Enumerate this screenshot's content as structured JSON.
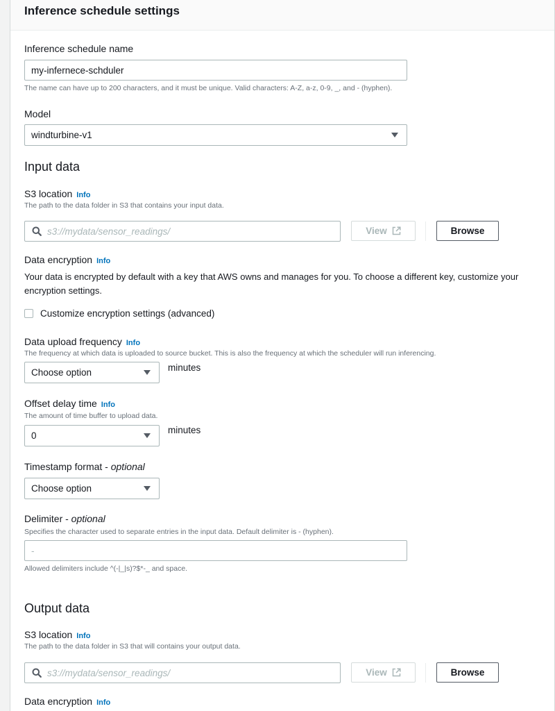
{
  "panel": {
    "title": "Inference schedule settings"
  },
  "name_field": {
    "label": "Inference schedule name",
    "value": "my-infernece-schduler",
    "hint": "The name can have up to 200 characters, and it must be unique. Valid characters: A-Z, a-z, 0-9, _, and - (hyphen)."
  },
  "model_field": {
    "label": "Model",
    "selected": "windturbine-v1"
  },
  "input_data": {
    "heading": "Input data",
    "s3": {
      "label": "S3 location",
      "info": "Info",
      "description": "The path to the data folder in S3 that contains your input data.",
      "placeholder": "s3://mydata/sensor_readings/",
      "view_label": "View",
      "browse_label": "Browse"
    },
    "encryption": {
      "label": "Data encryption",
      "info": "Info",
      "text": "Your data is encrypted by default with a key that AWS owns and manages for you. To choose a different key, customize your encryption settings.",
      "checkbox_label": "Customize encryption settings (advanced)",
      "checkbox_checked": false
    },
    "upload_frequency": {
      "label": "Data upload frequency",
      "info": "Info",
      "description": "The frequency at which data is uploaded to source bucket. This is also the frequency at which the scheduler will run inferencing.",
      "selected": "Choose option",
      "unit": "minutes"
    },
    "offset_delay": {
      "label": "Offset delay time",
      "info": "Info",
      "description": "The amount of time buffer to upload data.",
      "selected": "0",
      "unit": "minutes"
    },
    "timestamp_format": {
      "label": "Timestamp format - ",
      "optional": "optional",
      "selected": "Choose option"
    },
    "delimiter": {
      "label": "Delimiter - ",
      "optional": "optional",
      "description": "Specifies the character used to separate entries in the input data. Default delimiter is - (hyphen).",
      "placeholder": "-",
      "hint": "Allowed delimiters include ^(-|_|s)?$*-_ and space."
    }
  },
  "output_data": {
    "heading": "Output data",
    "s3": {
      "label": "S3 location",
      "info": "Info",
      "description": "The path to the data folder in S3 that will contains your output data.",
      "placeholder": "s3://mydata/sensor_readings/",
      "view_label": "View",
      "browse_label": "Browse"
    },
    "encryption": {
      "label": "Data encryption",
      "info": "Info"
    }
  }
}
